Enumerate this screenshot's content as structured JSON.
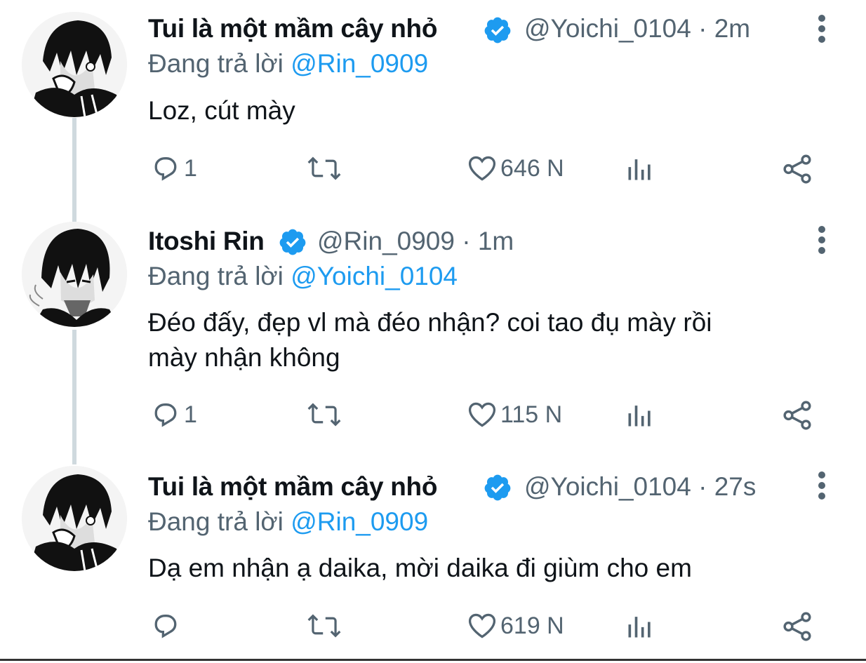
{
  "tweets": [
    {
      "display_name": "Tui là một mầm cây nhỏ",
      "handle_time": "@Yoichi_0104 · 2m",
      "reply_prefix": "Đang trả lời",
      "reply_mention": "@Rin_0909",
      "text": "Loz, cút mày",
      "reply_count": "1",
      "like_count": "646 N"
    },
    {
      "display_name": "Itoshi Rin",
      "handle_time": "@Rin_0909 · 1m",
      "reply_prefix": "Đang trả lời",
      "reply_mention": "@Yoichi_0104",
      "text_line1": "Đéo đấy, đẹp vl mà đéo nhận? coi tao đụ mày rồi",
      "text_line2": "mày nhận không",
      "reply_count": "1",
      "like_count": "115 N"
    },
    {
      "display_name": "Tui là một mầm cây nhỏ",
      "handle_time": "@Yoichi_0104 · 27s",
      "reply_prefix": "Đang trả lời",
      "reply_mention": "@Rin_0909",
      "text": "Dạ em nhận ạ daika, mời daika đi giùm cho em",
      "reply_count": "",
      "like_count": "619 N"
    }
  ],
  "colors": {
    "verified": "#1d9bf0",
    "mention": "#1d9bf0",
    "secondary_text": "#536471",
    "thread_line": "#cfd9de"
  },
  "icons": [
    "verified-badge-icon",
    "more-vertical-icon",
    "reply-icon",
    "retweet-icon",
    "like-icon",
    "analytics-icon",
    "share-icon"
  ]
}
